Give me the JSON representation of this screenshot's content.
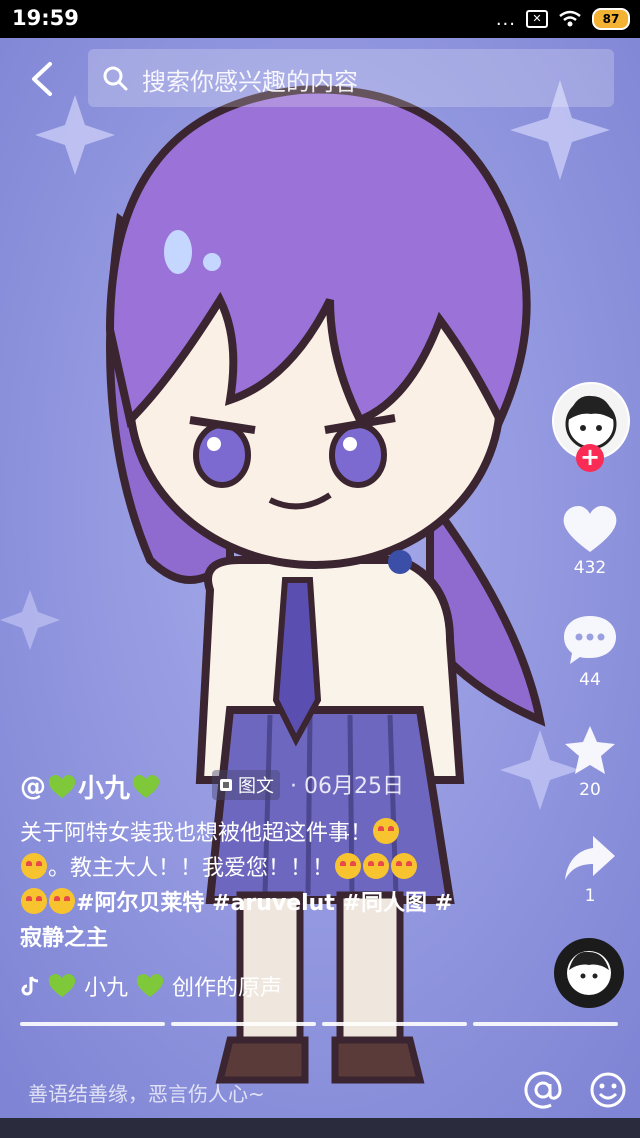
{
  "status_bar": {
    "time": "19:59",
    "dots": "...",
    "battery": "87"
  },
  "search": {
    "placeholder": "搜索你感兴趣的内容"
  },
  "side_actions": {
    "likes": "432",
    "comments": "44",
    "favorites": "20",
    "shares": "1"
  },
  "post": {
    "author_prefix": "@",
    "author_name": "小九",
    "type_label": "图文",
    "date": "· 06月25日",
    "caption_line1": "关于阿特女装我也想被他超这件事！",
    "caption_line2": "。教主大人！！我爱您！！！",
    "hashtags": "#阿尔贝莱特 #aruvelut #同人图 #",
    "caption_line4": "寂静之主",
    "music_name": "小九",
    "music_suffix": "创作的原声"
  },
  "comment": {
    "placeholder": "善语结善缘，恶言伤人心~"
  },
  "colors": {
    "accent_red": "#fa2c55",
    "heart_green": "#7ec83a",
    "background": "#8f94de"
  }
}
